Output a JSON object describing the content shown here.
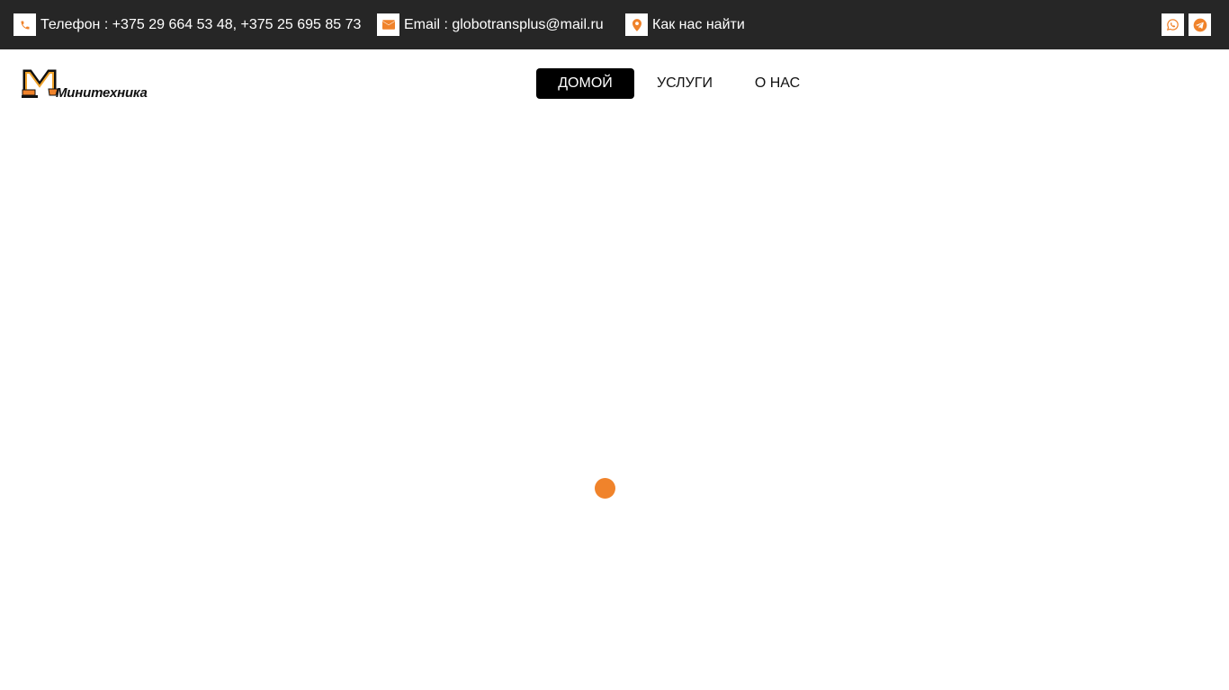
{
  "topbar": {
    "phone": {
      "icon": "phone-icon",
      "text": "Телефон : +375 29 664 53 48, +375 25 695 85 73"
    },
    "email": {
      "icon": "envelope-icon",
      "text": "Email : globotransplus@mail.ru"
    },
    "location": {
      "icon": "map-pin-icon",
      "text": "Как нас найти"
    },
    "social": [
      {
        "icon": "whatsapp-icon"
      },
      {
        "icon": "telegram-icon"
      }
    ]
  },
  "header": {
    "logo": {
      "text": "Минитехника",
      "icon": "excavator-logo-icon"
    },
    "nav": [
      {
        "label": "ДОМОЙ",
        "active": true
      },
      {
        "label": "УСЛУГИ",
        "active": false
      },
      {
        "label": "О НАС",
        "active": false
      }
    ]
  },
  "colors": {
    "topbar_bg": "#262626",
    "accent": "#f0832b",
    "nav_active_bg": "#000000"
  },
  "loader": {
    "icon": "loading-dot-icon"
  }
}
